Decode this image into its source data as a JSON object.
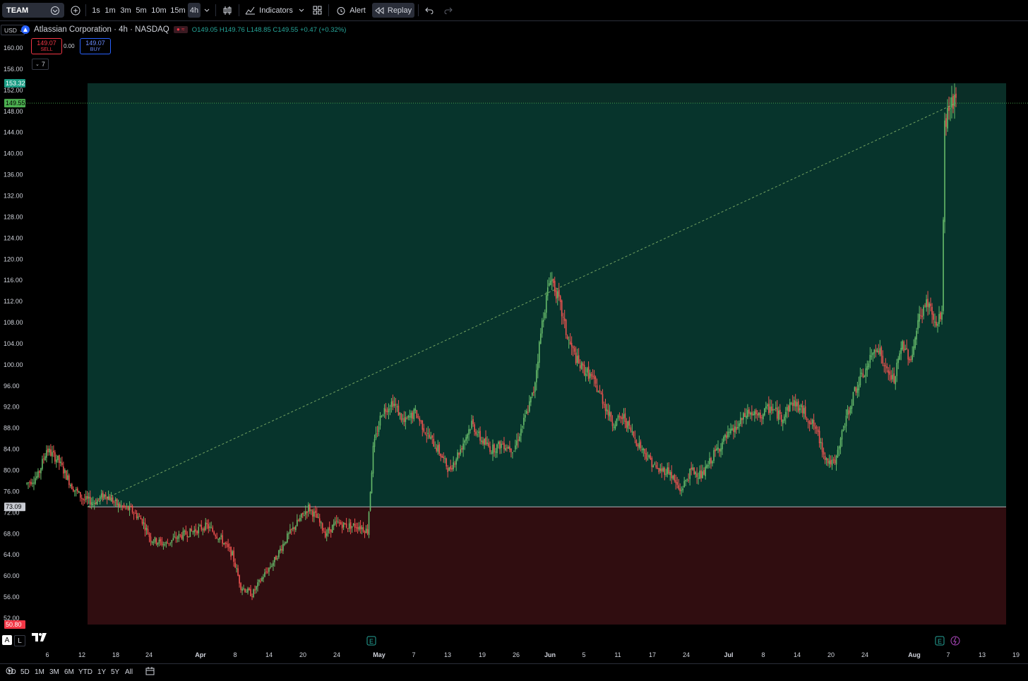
{
  "toolbar": {
    "symbol": "TEAM",
    "intervals": [
      "1s",
      "1m",
      "3m",
      "5m",
      "10m",
      "15m",
      "4h"
    ],
    "active_interval": "4h",
    "indicators_label": "Indicators",
    "alert_label": "Alert",
    "replay_label": "Replay"
  },
  "legend": {
    "currency": "USD",
    "title": "Atlassian Corporation · 4h · NASDAQ",
    "open": "O149.05",
    "high": "H149.76",
    "low": "L148.85",
    "close": "C149.55",
    "change": "+0.47 (+0.32%)",
    "sell_price": "149.07",
    "sell_label": "SELL",
    "buy_price": "149.07",
    "buy_label": "BUY",
    "spread": "0.00",
    "collapse_count": "7"
  },
  "bottom": {
    "ranges": [
      "1D",
      "5D",
      "1M",
      "3M",
      "6M",
      "YTD",
      "1Y",
      "5Y",
      "All"
    ],
    "scale_a": "A",
    "scale_l": "L"
  },
  "colors": {
    "up": "#26a69a",
    "down": "#ef5350",
    "upzone": "#07342c",
    "downzone": "#300d10",
    "last": "#4caf50"
  },
  "chart_data": {
    "type": "candlestick",
    "title": "",
    "xlabel": "",
    "ylabel": "",
    "ylim": [
      50,
      162
    ],
    "y_ticks": [
      "160.00",
      "156.00",
      "152.00",
      "148.00",
      "144.00",
      "140.00",
      "136.00",
      "132.00",
      "128.00",
      "124.00",
      "120.00",
      "116.00",
      "112.00",
      "108.00",
      "104.00",
      "100.00",
      "96.00",
      "92.00",
      "88.00",
      "84.00",
      "80.00",
      "76.00",
      "72.00",
      "68.00",
      "64.00",
      "60.00",
      "56.00",
      "52.00"
    ],
    "x_ticks": [
      "6",
      "12",
      "18",
      "24",
      "Apr",
      "8",
      "14",
      "20",
      "24",
      "May",
      "7",
      "13",
      "19",
      "26",
      "Jun",
      "5",
      "11",
      "17",
      "24",
      "Jul",
      "8",
      "14",
      "20",
      "24",
      "Aug",
      "7",
      "13",
      "19"
    ],
    "price_labels": {
      "target": "153.32",
      "last": "149.55",
      "entry": "73.09",
      "stop": "50.80"
    },
    "position": {
      "entry": 73.09,
      "target": 153.32,
      "stop": 50.8
    },
    "close_path": [
      {
        "i": 0,
        "v": 77.5
      },
      {
        "i": 8,
        "v": 79
      },
      {
        "i": 14,
        "v": 84
      },
      {
        "i": 22,
        "v": 82
      },
      {
        "i": 32,
        "v": 77
      },
      {
        "i": 40,
        "v": 74.5
      },
      {
        "i": 48,
        "v": 74
      },
      {
        "i": 56,
        "v": 75.5
      },
      {
        "i": 64,
        "v": 73.5
      },
      {
        "i": 74,
        "v": 72.5
      },
      {
        "i": 82,
        "v": 70.5
      },
      {
        "i": 88,
        "v": 67
      },
      {
        "i": 98,
        "v": 66
      },
      {
        "i": 108,
        "v": 67.5
      },
      {
        "i": 118,
        "v": 68.5
      },
      {
        "i": 128,
        "v": 69.5
      },
      {
        "i": 138,
        "v": 67
      },
      {
        "i": 146,
        "v": 64
      },
      {
        "i": 152,
        "v": 58
      },
      {
        "i": 160,
        "v": 56.5
      },
      {
        "i": 168,
        "v": 60
      },
      {
        "i": 176,
        "v": 63
      },
      {
        "i": 184,
        "v": 67
      },
      {
        "i": 192,
        "v": 70
      },
      {
        "i": 200,
        "v": 73
      },
      {
        "i": 206,
        "v": 71
      },
      {
        "i": 212,
        "v": 68
      },
      {
        "i": 220,
        "v": 70
      },
      {
        "i": 228,
        "v": 69.5
      },
      {
        "i": 236,
        "v": 69.5
      },
      {
        "i": 242,
        "v": 68.5
      },
      {
        "i": 246,
        "v": 84
      },
      {
        "i": 252,
        "v": 91
      },
      {
        "i": 260,
        "v": 93
      },
      {
        "i": 268,
        "v": 89
      },
      {
        "i": 276,
        "v": 91
      },
      {
        "i": 284,
        "v": 87
      },
      {
        "i": 292,
        "v": 84
      },
      {
        "i": 300,
        "v": 80
      },
      {
        "i": 308,
        "v": 84
      },
      {
        "i": 316,
        "v": 89
      },
      {
        "i": 322,
        "v": 86
      },
      {
        "i": 330,
        "v": 84
      },
      {
        "i": 338,
        "v": 85
      },
      {
        "i": 346,
        "v": 84
      },
      {
        "i": 354,
        "v": 90
      },
      {
        "i": 360,
        "v": 95
      },
      {
        "i": 366,
        "v": 108
      },
      {
        "i": 372,
        "v": 117
      },
      {
        "i": 378,
        "v": 112
      },
      {
        "i": 384,
        "v": 105
      },
      {
        "i": 392,
        "v": 100
      },
      {
        "i": 400,
        "v": 98
      },
      {
        "i": 408,
        "v": 94
      },
      {
        "i": 416,
        "v": 89
      },
      {
        "i": 424,
        "v": 90
      },
      {
        "i": 432,
        "v": 86
      },
      {
        "i": 440,
        "v": 83
      },
      {
        "i": 448,
        "v": 80
      },
      {
        "i": 456,
        "v": 80
      },
      {
        "i": 464,
        "v": 76
      },
      {
        "i": 472,
        "v": 80
      },
      {
        "i": 480,
        "v": 79
      },
      {
        "i": 488,
        "v": 83
      },
      {
        "i": 496,
        "v": 86
      },
      {
        "i": 504,
        "v": 88
      },
      {
        "i": 512,
        "v": 91
      },
      {
        "i": 520,
        "v": 90
      },
      {
        "i": 528,
        "v": 92
      },
      {
        "i": 536,
        "v": 90
      },
      {
        "i": 544,
        "v": 93
      },
      {
        "i": 552,
        "v": 91
      },
      {
        "i": 560,
        "v": 88
      },
      {
        "i": 568,
        "v": 82
      },
      {
        "i": 574,
        "v": 81
      },
      {
        "i": 580,
        "v": 88
      },
      {
        "i": 588,
        "v": 95
      },
      {
        "i": 596,
        "v": 99
      },
      {
        "i": 604,
        "v": 104
      },
      {
        "i": 610,
        "v": 99
      },
      {
        "i": 616,
        "v": 97
      },
      {
        "i": 622,
        "v": 104
      },
      {
        "i": 628,
        "v": 101
      },
      {
        "i": 634,
        "v": 109
      },
      {
        "i": 640,
        "v": 112
      },
      {
        "i": 646,
        "v": 107
      },
      {
        "i": 650,
        "v": 110
      },
      {
        "i": 652,
        "v": 145
      },
      {
        "i": 656,
        "v": 150
      },
      {
        "i": 660,
        "v": 149.55
      }
    ],
    "total_bars": 661
  }
}
